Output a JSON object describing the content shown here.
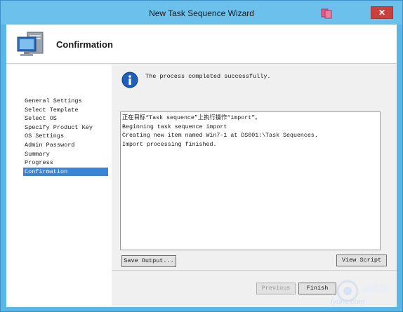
{
  "window": {
    "title": "New Task Sequence Wizard",
    "close_label": "✕"
  },
  "header": {
    "title": "Confirmation",
    "icon": "computer-icon"
  },
  "nav": {
    "items": [
      {
        "label": "General Settings",
        "active": false
      },
      {
        "label": "Select Template",
        "active": false
      },
      {
        "label": "Select OS",
        "active": false
      },
      {
        "label": "Specify Product Key",
        "active": false
      },
      {
        "label": "OS Settings",
        "active": false
      },
      {
        "label": "Admin Password",
        "active": false
      },
      {
        "label": "Summary",
        "active": false
      },
      {
        "label": "Progress",
        "active": false
      },
      {
        "label": "Confirmation",
        "active": true
      }
    ]
  },
  "main": {
    "status_icon": "info-icon",
    "status_text": "The process completed successfully.",
    "log_lines": [
      "正在目标“Task sequence”上执行操作“import”。",
      "Beginning task sequence import",
      "Creating new item named Win7-1 at DS001:\\Task Sequences.",
      "Import processing finished."
    ],
    "save_output_label": "Save Output...",
    "view_script_label": "View Script"
  },
  "footer": {
    "previous_label": "Previous",
    "finish_label": "Finish"
  },
  "watermark": {
    "line1": "运维网",
    "line2": "iyunv.com"
  },
  "colors": {
    "title_bar": "#6bc0ec",
    "close": "#c9413a",
    "selection": "#3a84d7",
    "info": "#1f5fb8"
  }
}
